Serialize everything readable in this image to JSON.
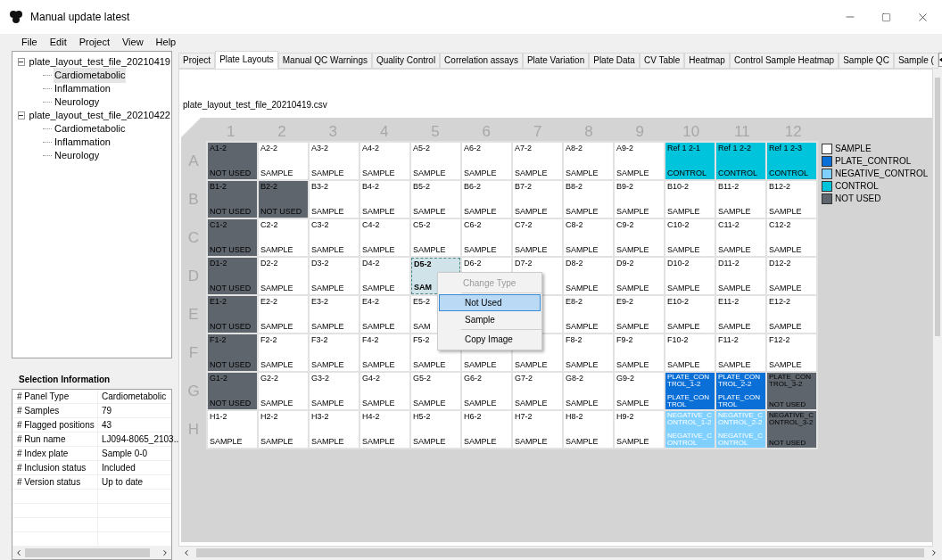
{
  "window": {
    "title": "Manual update latest"
  },
  "menu": [
    "File",
    "Edit",
    "Project",
    "View",
    "Help"
  ],
  "tree": [
    {
      "label": "plate_layout_test_file_20210419",
      "expanded": true,
      "children": [
        {
          "label": "Cardiometabolic",
          "selected": true
        },
        {
          "label": "Inflammation",
          "selected": false
        },
        {
          "label": "Neurology",
          "selected": false
        }
      ]
    },
    {
      "label": "plate_layout_test_file_20210422",
      "expanded": true,
      "children": [
        {
          "label": "Cardiometabolic",
          "selected": false
        },
        {
          "label": "Inflammation",
          "selected": false
        },
        {
          "label": "Neurology",
          "selected": false
        }
      ]
    }
  ],
  "selection_info": {
    "title": "Selection Information",
    "rows": [
      [
        "# Panel Type",
        "Cardiometabolic"
      ],
      [
        "# Samples",
        "79"
      ],
      [
        "# Flagged positions",
        "43"
      ],
      [
        "# Run name",
        "LJ094-8065_2103.."
      ],
      [
        "# Index plate",
        "Sample 0-0"
      ],
      [
        "# Inclusion status",
        "Included"
      ],
      [
        "# Version status",
        "Up to date"
      ]
    ]
  },
  "tabs": [
    {
      "label": "Project",
      "selected": false
    },
    {
      "label": "Plate Layouts",
      "selected": true
    },
    {
      "label": "Manual QC Warnings",
      "selected": false
    },
    {
      "label": "Quality Control",
      "selected": false
    },
    {
      "label": "Correlation assays",
      "selected": false
    },
    {
      "label": "Plate Variation",
      "selected": false
    },
    {
      "label": "Plate Data",
      "selected": false
    },
    {
      "label": "CV Table",
      "selected": false
    },
    {
      "label": "Heatmap",
      "selected": false
    },
    {
      "label": "Control Sample Heatmap",
      "selected": false
    },
    {
      "label": "Sample QC",
      "selected": false
    },
    {
      "label": "Sample (",
      "selected": false
    }
  ],
  "file_name": "plate_layout_test_file_20210419.csv",
  "columns": [
    "1",
    "2",
    "3",
    "4",
    "5",
    "6",
    "7",
    "8",
    "9",
    "10",
    "11",
    "12"
  ],
  "rows": [
    {
      "letter": "A",
      "wells": [
        {
          "id": "A1-2",
          "label": "NOT USED",
          "kind": "not_used",
          "selected": false
        },
        {
          "id": "A2-2",
          "label": "SAMPLE",
          "kind": "sample",
          "selected": false
        },
        {
          "id": "A3-2",
          "label": "SAMPLE",
          "kind": "sample",
          "selected": false
        },
        {
          "id": "A4-2",
          "label": "SAMPLE",
          "kind": "sample",
          "selected": false
        },
        {
          "id": "A5-2",
          "label": "SAMPLE",
          "kind": "sample",
          "selected": false
        },
        {
          "id": "A6-2",
          "label": "SAMPLE",
          "kind": "sample",
          "selected": false
        },
        {
          "id": "A7-2",
          "label": "SAMPLE",
          "kind": "sample",
          "selected": false
        },
        {
          "id": "A8-2",
          "label": "SAMPLE",
          "kind": "sample",
          "selected": false
        },
        {
          "id": "A9-2",
          "label": "SAMPLE",
          "kind": "sample",
          "selected": false
        },
        {
          "id": "Ref 1 2-1",
          "label": "CONTROL",
          "kind": "control",
          "selected": false
        },
        {
          "id": "Ref 1 2-2",
          "label": "CONTROL",
          "kind": "control",
          "selected": false
        },
        {
          "id": "Ref 1 2-3",
          "label": "CONTROL",
          "kind": "control",
          "selected": false
        }
      ]
    },
    {
      "letter": "B",
      "wells": [
        {
          "id": "B1-2",
          "label": "NOT USED",
          "kind": "not_used",
          "selected": false
        },
        {
          "id": "B2-2",
          "label": "NOT USED",
          "kind": "not_used",
          "selected": false
        },
        {
          "id": "B3-2",
          "label": "SAMPLE",
          "kind": "sample",
          "selected": false
        },
        {
          "id": "B4-2",
          "label": "SAMPLE",
          "kind": "sample",
          "selected": false
        },
        {
          "id": "B5-2",
          "label": "SAMPLE",
          "kind": "sample",
          "selected": false
        },
        {
          "id": "B6-2",
          "label": "SAMPLE",
          "kind": "sample",
          "selected": false
        },
        {
          "id": "B7-2",
          "label": "SAMPLE",
          "kind": "sample",
          "selected": false
        },
        {
          "id": "B8-2",
          "label": "SAMPLE",
          "kind": "sample",
          "selected": false
        },
        {
          "id": "B9-2",
          "label": "SAMPLE",
          "kind": "sample",
          "selected": false
        },
        {
          "id": "B10-2",
          "label": "SAMPLE",
          "kind": "sample",
          "selected": false
        },
        {
          "id": "B11-2",
          "label": "SAMPLE",
          "kind": "sample",
          "selected": false
        },
        {
          "id": "B12-2",
          "label": "SAMPLE",
          "kind": "sample",
          "selected": false
        }
      ]
    },
    {
      "letter": "C",
      "wells": [
        {
          "id": "C1-2",
          "label": "NOT USED",
          "kind": "not_used",
          "selected": false
        },
        {
          "id": "C2-2",
          "label": "SAMPLE",
          "kind": "sample",
          "selected": false
        },
        {
          "id": "C3-2",
          "label": "SAMPLE",
          "kind": "sample",
          "selected": false
        },
        {
          "id": "C4-2",
          "label": "SAMPLE",
          "kind": "sample",
          "selected": false
        },
        {
          "id": "C5-2",
          "label": "SAMPLE",
          "kind": "sample",
          "selected": false
        },
        {
          "id": "C6-2",
          "label": "SAMPLE",
          "kind": "sample",
          "selected": false
        },
        {
          "id": "C7-2",
          "label": "SAMPLE",
          "kind": "sample",
          "selected": false
        },
        {
          "id": "C8-2",
          "label": "SAMPLE",
          "kind": "sample",
          "selected": false
        },
        {
          "id": "C9-2",
          "label": "SAMPLE",
          "kind": "sample",
          "selected": false
        },
        {
          "id": "C10-2",
          "label": "SAMPLE",
          "kind": "sample",
          "selected": false
        },
        {
          "id": "C11-2",
          "label": "SAMPLE",
          "kind": "sample",
          "selected": false
        },
        {
          "id": "C12-2",
          "label": "SAMPLE",
          "kind": "sample",
          "selected": false
        }
      ]
    },
    {
      "letter": "D",
      "wells": [
        {
          "id": "D1-2",
          "label": "NOT USED",
          "kind": "not_used",
          "selected": false
        },
        {
          "id": "D2-2",
          "label": "SAMPLE",
          "kind": "sample",
          "selected": false
        },
        {
          "id": "D3-2",
          "label": "SAMPLE",
          "kind": "sample",
          "selected": false
        },
        {
          "id": "D4-2",
          "label": "SAMPLE",
          "kind": "sample",
          "selected": false
        },
        {
          "id": "D5-2",
          "label": "SAM",
          "kind": "sample",
          "selected": true
        },
        {
          "id": "D6-2",
          "kind": "sample",
          "selected": false
        },
        {
          "id": "D7-2",
          "kind": "sample",
          "selected": false
        },
        {
          "id": "D8-2",
          "label": "SAMPLE",
          "kind": "sample",
          "selected": false
        },
        {
          "id": "D9-2",
          "label": "SAMPLE",
          "kind": "sample",
          "selected": false
        },
        {
          "id": "D10-2",
          "label": "SAMPLE",
          "kind": "sample",
          "selected": false
        },
        {
          "id": "D11-2",
          "label": "SAMPLE",
          "kind": "sample",
          "selected": false
        },
        {
          "id": "D12-2",
          "label": "SAMPLE",
          "kind": "sample",
          "selected": false
        }
      ]
    },
    {
      "letter": "E",
      "wells": [
        {
          "id": "E1-2",
          "label": "NOT USED",
          "kind": "not_used",
          "selected": false
        },
        {
          "id": "E2-2",
          "label": "SAMPLE",
          "kind": "sample",
          "selected": false
        },
        {
          "id": "E3-2",
          "label": "SAMPLE",
          "kind": "sample",
          "selected": false
        },
        {
          "id": "E4-2",
          "label": "SAMPLE",
          "kind": "sample",
          "selected": false
        },
        {
          "id": "E5-2",
          "label": "SAM",
          "kind": "sample",
          "selected": false
        },
        {
          "kind": "covered"
        },
        {
          "kind": "sample"
        },
        {
          "id": "E8-2",
          "label": "SAMPLE",
          "kind": "sample",
          "selected": false
        },
        {
          "id": "E9-2",
          "label": "SAMPLE",
          "kind": "sample",
          "selected": false
        },
        {
          "id": "E10-2",
          "label": "SAMPLE",
          "kind": "sample",
          "selected": false
        },
        {
          "id": "E11-2",
          "label": "SAMPLE",
          "kind": "sample",
          "selected": false
        },
        {
          "id": "E12-2",
          "label": "SAMPLE",
          "kind": "sample",
          "selected": false
        }
      ]
    },
    {
      "letter": "F",
      "wells": [
        {
          "id": "F1-2",
          "label": "NOT USED",
          "kind": "not_used",
          "selected": false
        },
        {
          "id": "F2-2",
          "label": "SAMPLE",
          "kind": "sample",
          "selected": false
        },
        {
          "id": "F3-2",
          "label": "SAMPLE",
          "kind": "sample",
          "selected": false
        },
        {
          "id": "F4-2",
          "label": "SAMPLE",
          "kind": "sample",
          "selected": false
        },
        {
          "id": "F5-2",
          "label": "SAMPLE",
          "kind": "sample",
          "selected": false
        },
        {
          "label": "SAMPLE",
          "kind": "sample",
          "selected": false
        },
        {
          "label": "SAMPLE",
          "kind": "sample",
          "selected": false
        },
        {
          "id": "F8-2",
          "label": "SAMPLE",
          "kind": "sample",
          "selected": false
        },
        {
          "id": "F9-2",
          "label": "SAMPLE",
          "kind": "sample",
          "selected": false
        },
        {
          "id": "F10-2",
          "label": "SAMPLE",
          "kind": "sample",
          "selected": false
        },
        {
          "id": "F11-2",
          "label": "SAMPLE",
          "kind": "sample",
          "selected": false
        },
        {
          "id": "F12-2",
          "label": "SAMPLE",
          "kind": "sample",
          "selected": false
        }
      ]
    },
    {
      "letter": "G",
      "wells": [
        {
          "id": "G1-2",
          "label": "NOT USED",
          "kind": "not_used",
          "selected": false
        },
        {
          "id": "G2-2",
          "label": "SAMPLE",
          "kind": "sample",
          "selected": false
        },
        {
          "id": "G3-2",
          "label": "SAMPLE",
          "kind": "sample",
          "selected": false
        },
        {
          "id": "G4-2",
          "label": "SAMPLE",
          "kind": "sample",
          "selected": false
        },
        {
          "id": "G5-2",
          "label": "SAMPLE",
          "kind": "sample",
          "selected": false
        },
        {
          "id": "G6-2",
          "label": "SAMPLE",
          "kind": "sample",
          "selected": false
        },
        {
          "id": "G7-2",
          "label": "SAMPLE",
          "kind": "sample",
          "selected": false
        },
        {
          "id": "G8-2",
          "label": "SAMPLE",
          "kind": "sample",
          "selected": false
        },
        {
          "id": "G9-2",
          "label": "SAMPLE",
          "kind": "sample",
          "selected": false
        },
        {
          "id": "PLATE_CONTROL_1-2",
          "label": "PLATE_CONTROL",
          "kind": "plate_control",
          "selected": false
        },
        {
          "id": "PLATE_CONTROL_2-2",
          "label": "PLATE_CONTROL",
          "kind": "plate_control",
          "selected": false
        },
        {
          "id": "PLATE_CONTROL_3-2",
          "label": "NOT USED",
          "kind": "not_used",
          "selected": false
        }
      ]
    },
    {
      "letter": "H",
      "wells": [
        {
          "id": "H1-2",
          "label": "SAMPLE",
          "kind": "sample",
          "selected": false
        },
        {
          "id": "H2-2",
          "label": "SAMPLE",
          "kind": "sample",
          "selected": false
        },
        {
          "id": "H3-2",
          "label": "SAMPLE",
          "kind": "sample",
          "selected": false
        },
        {
          "id": "H4-2",
          "label": "SAMPLE",
          "kind": "sample",
          "selected": false
        },
        {
          "id": "H5-2",
          "label": "SAMPLE",
          "kind": "sample",
          "selected": false
        },
        {
          "id": "H6-2",
          "label": "SAMPLE",
          "kind": "sample",
          "selected": false
        },
        {
          "id": "H7-2",
          "label": "SAMPLE",
          "kind": "sample",
          "selected": false
        },
        {
          "id": "H8-2",
          "label": "SAMPLE",
          "kind": "sample",
          "selected": false
        },
        {
          "id": "H9-2",
          "label": "SAMPLE",
          "kind": "sample",
          "selected": false
        },
        {
          "id": "NEGATIVE_CONTROL_1-2",
          "label": "NEGATIVE_CONTROL",
          "kind": "negative_control",
          "selected": false
        },
        {
          "id": "NEGATIVE_CONTROL_2-2",
          "label": "NEGATIVE_CONTROL",
          "kind": "negative_control",
          "selected": false
        },
        {
          "id": "NEGATIVE_CONTROL_3-2",
          "label": "NOT USED",
          "kind": "not_used",
          "selected": false
        }
      ]
    }
  ],
  "legend": [
    {
      "label": "SAMPLE",
      "color": "#ffffff"
    },
    {
      "label": "PLATE_CONTROL",
      "color": "#0a6fd6"
    },
    {
      "label": "NEGATIVE_CONTROL",
      "color": "#7fd0ff"
    },
    {
      "label": "CONTROL",
      "color": "#00c3dc"
    },
    {
      "label": "NOT USED",
      "color": "#5f656d"
    }
  ],
  "context_menu": [
    {
      "kind": "header",
      "label": "Change Type",
      "disabled": true
    },
    {
      "kind": "item",
      "label": "Not Used",
      "disabled": false,
      "selected": true
    },
    {
      "kind": "item",
      "label": "Sample",
      "disabled": false,
      "selected": false
    },
    {
      "kind": "separator"
    },
    {
      "kind": "item",
      "label": "Copy Image",
      "disabled": false,
      "selected": false
    }
  ]
}
